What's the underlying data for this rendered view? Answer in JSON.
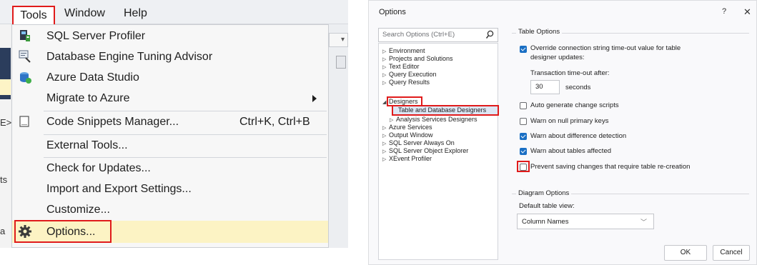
{
  "menubar": {
    "items": [
      "Tools",
      "Window",
      "Help"
    ]
  },
  "background": {
    "left_fragments": [
      "E>",
      "ts",
      "a"
    ]
  },
  "tools_menu": {
    "items": [
      {
        "label": "SQL Server Profiler",
        "icon": "profiler-icon"
      },
      {
        "label": "Database Engine Tuning Advisor",
        "icon": "tuning-advisor-icon"
      },
      {
        "label": "Azure Data Studio",
        "icon": "azure-data-studio-icon"
      },
      {
        "label": "Migrate to Azure",
        "has_submenu": true
      },
      {
        "label": "Code Snippets Manager...",
        "shortcut": "Ctrl+K, Ctrl+B",
        "icon": "snippet-icon"
      },
      {
        "label": "External Tools..."
      },
      {
        "label": "Check for Updates..."
      },
      {
        "label": "Import and Export Settings..."
      },
      {
        "label": "Customize..."
      },
      {
        "label": "Options...",
        "icon": "gear-icon",
        "highlighted": true
      }
    ]
  },
  "options_dialog": {
    "title": "Options",
    "help_glyph": "?",
    "close_glyph": "✕",
    "search_placeholder": "Search Options (Ctrl+E)",
    "tree": [
      {
        "label": "Environment",
        "expander": "▷"
      },
      {
        "label": "Projects and Solutions",
        "expander": "▷"
      },
      {
        "label": "Text Editor",
        "expander": "▷"
      },
      {
        "label": "Query Execution",
        "expander": "▷"
      },
      {
        "label": "Query Results",
        "expander": "▷"
      },
      {
        "label": "Designers",
        "expander": "◢"
      },
      {
        "label": "Table and Database Designers",
        "selected": true
      },
      {
        "label": "Analysis Services Designers",
        "expander": "▷"
      },
      {
        "label": "Azure Services",
        "expander": "▷"
      },
      {
        "label": "Output Window",
        "expander": "▷"
      },
      {
        "label": "SQL Server Always On",
        "expander": "▷"
      },
      {
        "label": "SQL Server Object Explorer",
        "expander": "▷"
      },
      {
        "label": "XEvent Profiler",
        "expander": "▷"
      }
    ],
    "table_options": {
      "heading": "Table Options",
      "override_timeout": {
        "label_line1": "Override connection string time-out value for table",
        "label_line2": "designer updates:",
        "checked": true
      },
      "transaction_timeout_label": "Transaction time-out after:",
      "timeout_value": "30",
      "timeout_unit": "seconds",
      "checkboxes": [
        {
          "label": "Auto generate change scripts",
          "checked": false
        },
        {
          "label": "Warn on null primary keys",
          "checked": false
        },
        {
          "label": "Warn about difference detection",
          "checked": true
        },
        {
          "label": "Warn about tables affected",
          "checked": true
        },
        {
          "label": "Prevent saving changes that require table re-creation",
          "checked": false
        }
      ]
    },
    "diagram_options": {
      "heading": "Diagram Options",
      "default_view_label": "Default table view:",
      "default_view_value": "Column Names"
    },
    "buttons": {
      "ok": "OK",
      "cancel": "Cancel"
    },
    "accent_color": "#1a6fc4",
    "highlight_color": "#e01b1b"
  }
}
